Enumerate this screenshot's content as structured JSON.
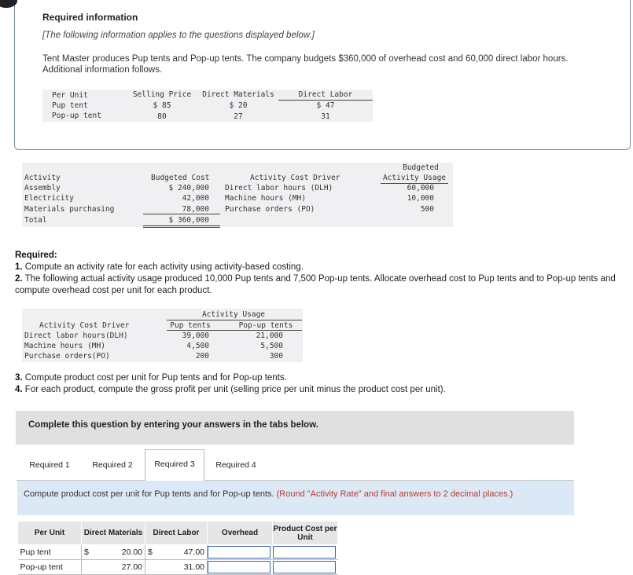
{
  "info": {
    "title": "Required information",
    "note": "[The following information applies to the questions displayed below.]",
    "paragraph": "Tent Master produces Pup tents and Pop-up tents. The company budgets $360,000 of overhead cost and 60,000 direct labor hours. Additional information follows.",
    "table": {
      "headers": [
        "Per Unit",
        "Selling Price",
        "Direct Materials",
        "Direct Labor"
      ],
      "rows": [
        [
          "Pup tent",
          "$ 85",
          "$ 20",
          "$ 47"
        ],
        [
          "Pop-up tent",
          "80",
          "27",
          "31"
        ]
      ]
    }
  },
  "activity_table": {
    "header_top": "Budgeted",
    "headers": [
      "Activity",
      "Budgeted Cost",
      "Activity Cost Driver",
      "Activity Usage"
    ],
    "rows": [
      [
        "Assembly",
        "$ 240,000",
        "Direct labor hours (DLH)",
        "60,000"
      ],
      [
        "Electricity",
        "42,000",
        "Machine hours (MH)",
        "10,000"
      ],
      [
        "Materials purchasing",
        "78,000",
        "Purchase orders (PO)",
        "500"
      ]
    ],
    "total": [
      "Total",
      "$ 360,000"
    ]
  },
  "required": {
    "heading": "Required:",
    "item1_num": "1.",
    "item1": " Compute an activity rate for each activity using activity-based costing.",
    "item2_num": "2.",
    "item2": " The following actual activity usage produced 10,000 Pup tents and 7,500 Pop-up tents. Allocate overhead cost to Pup tents and to Pop-up tents and compute overhead cost per unit for each product.",
    "item3_num": "3.",
    "item3": " Compute product cost per unit for Pup tents and for Pop-up tents.",
    "item4_num": "4.",
    "item4": " For each product, compute the gross profit per unit (selling price per unit minus the product cost per unit)."
  },
  "usage_table": {
    "group_header": "Activity Usage",
    "headers": [
      "Activity Cost Driver",
      "Pup tents",
      "Pop-up tents"
    ],
    "rows": [
      [
        "Direct labor hours(DLH)",
        "39,000",
        "21,000"
      ],
      [
        "Machine hours (MH)",
        "4,500",
        "5,500"
      ],
      [
        "Purchase orders(PO)",
        "200",
        "300"
      ]
    ]
  },
  "complete_bar": "Complete this question by entering your answers in the tabs below.",
  "tabs": [
    "Required 1",
    "Required 2",
    "Required 3",
    "Required 4"
  ],
  "active_tab": "Required 3",
  "instruction": {
    "text": "Compute product cost per unit for Pup tents and for Pop-up tents. ",
    "note": "(Round \"Activity Rate\" and final answers to 2 decimal places.)"
  },
  "answer_table": {
    "headers": [
      "Per Unit",
      "Direct Materials",
      "Direct Labor",
      "Overhead",
      "Product Cost per Unit"
    ],
    "rows": [
      {
        "label": "Pup tent",
        "dm_sym": "$",
        "dm": "20.00",
        "dl_sym": "$",
        "dl": "47.00",
        "overhead": "",
        "product_cost": ""
      },
      {
        "label": "Pop-up tent",
        "dm_sym": "",
        "dm": "27.00",
        "dl_sym": "",
        "dl": "31.00",
        "overhead": "",
        "product_cost": ""
      }
    ]
  }
}
